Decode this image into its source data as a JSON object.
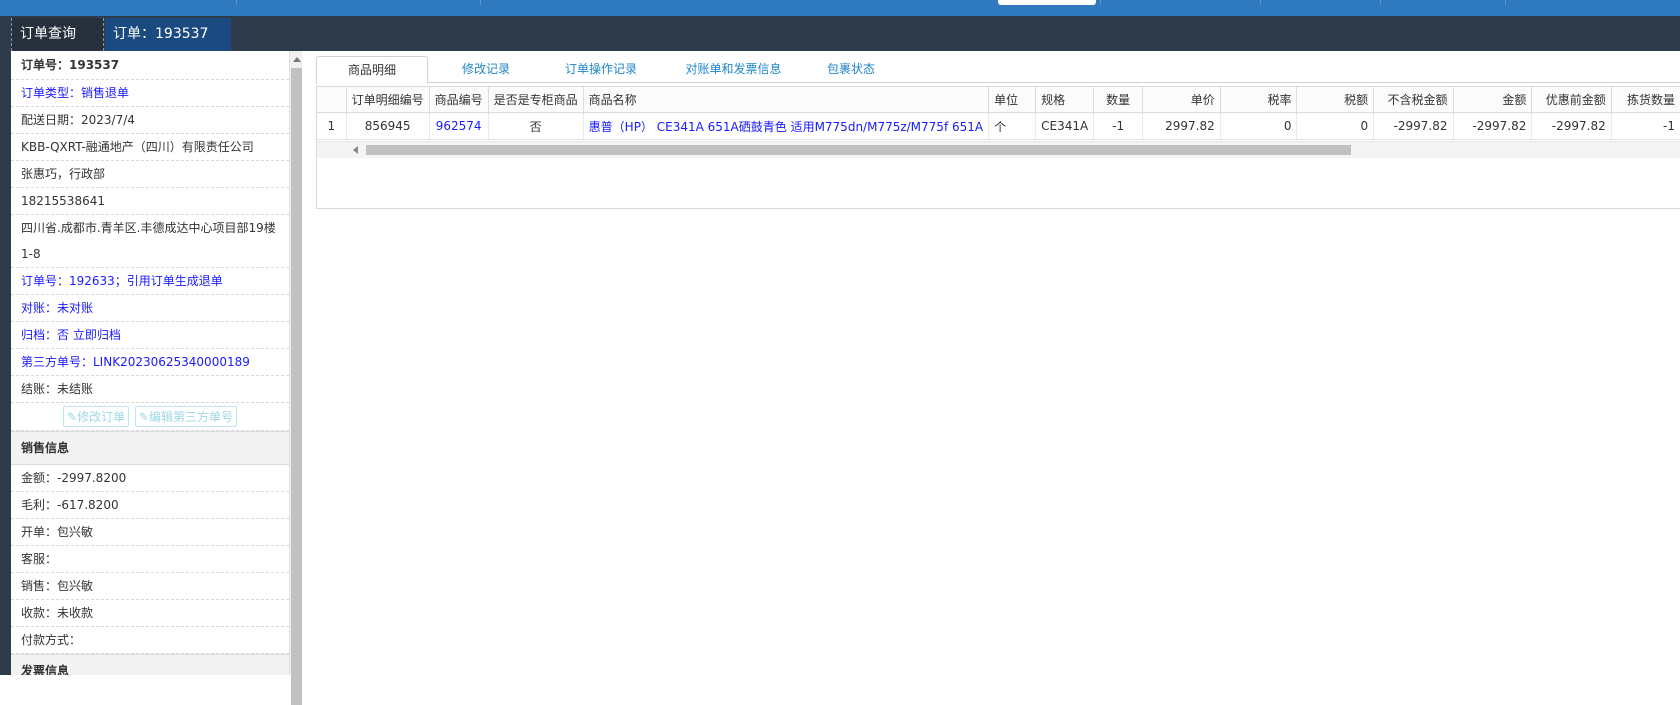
{
  "tabs": [
    {
      "label": "订单查询"
    },
    {
      "label": "订单：193537"
    }
  ],
  "left": {
    "order_no": "订单号：193537",
    "order_type": "订单类型：销售退单",
    "delivery_date": "配送日期：2023/7/4",
    "customer": "KBB-QXRT-融通地产（四川）有限责任公司",
    "contact": "张惠巧，行政部",
    "phone": "18215538641",
    "address": "四川省.成都市.青羊区.丰德成达中心项目部19楼1-8",
    "ref_order": "订单号：192633；引用订单生成退单",
    "reconcile": "对账：未对账",
    "archive": "归档：否 立即归档",
    "third_party": "第三方单号：LINK20230625340000189",
    "settle": "结账：未结账",
    "btn_edit_order": "修改订单",
    "btn_edit_third": "编辑第三方单号",
    "sales_section": "销售信息",
    "amount": "金额：-2997.8200",
    "profit": "毛利：-617.8200",
    "issuer": "开单：包兴敏",
    "service": "客服：",
    "salesman": "销售：包兴敏",
    "collection": "收款：未收款",
    "payment": "付款方式：",
    "invoice_section": "发票信息"
  },
  "subtabs": [
    "商品明细",
    "修改记录",
    "订单操作记录",
    "对账单和发票信息",
    "包裹状态"
  ],
  "table": {
    "headers": [
      "",
      "订单明细编号",
      "商品编号",
      "是否是专柜商品",
      "商品名称",
      "单位",
      "规格",
      "数量",
      "单价",
      "税率",
      "税额",
      "不含税金额",
      "金额",
      "优惠前金额",
      "拣货数量"
    ],
    "rows": [
      [
        "1",
        "856945",
        "962574",
        "否",
        "惠普（HP） CE341A 651A硒鼓青色 适用M775dn/M775z/M775f 651A",
        "个",
        "CE341A",
        "-1",
        "2997.82",
        "0",
        "0",
        "-2997.82",
        "-2997.82",
        "-2997.82",
        "-1"
      ]
    ]
  },
  "colors": {
    "topbar": "#2f7abf",
    "tabbar": "#2e3b4a",
    "active_tab": "#1a4a80",
    "link": "#1a1aff",
    "subtab_link": "#1f86c8"
  }
}
